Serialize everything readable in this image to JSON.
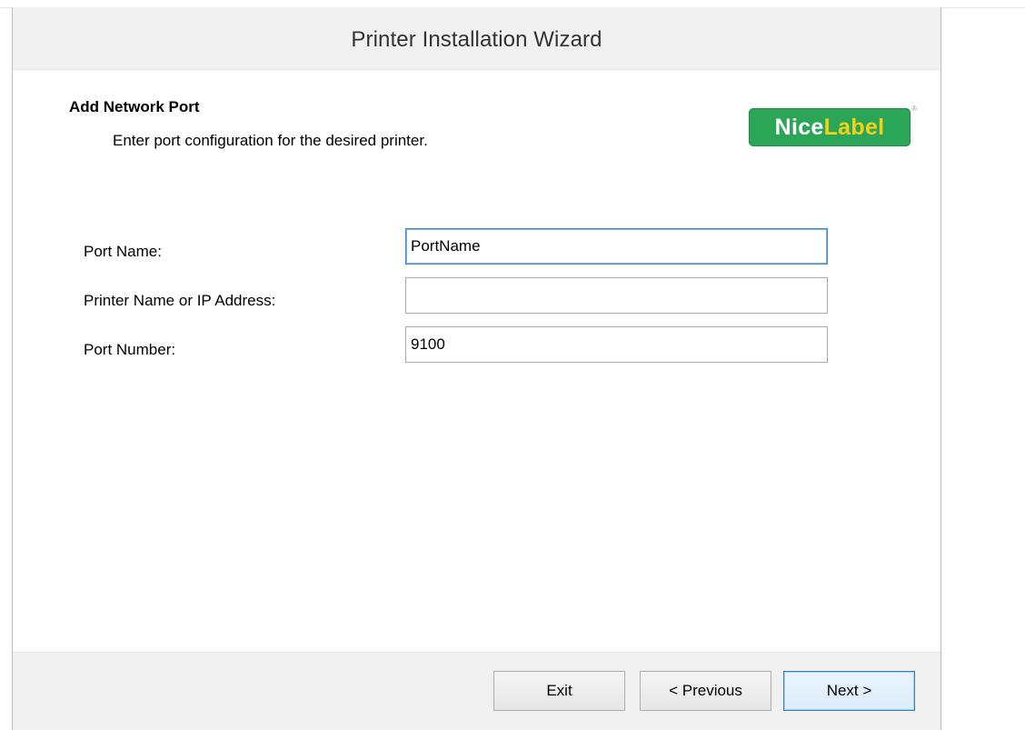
{
  "window": {
    "title": "Printer Installation Wizard"
  },
  "page": {
    "heading": "Add Network Port",
    "subheading": "Enter port configuration for the desired printer."
  },
  "logo": {
    "part1": "Nice",
    "part2": "Label",
    "registered": "®",
    "colors": {
      "background": "#2aa656",
      "nice": "#ffffff",
      "label": "#f3d11a"
    }
  },
  "form": {
    "port_name": {
      "label": "Port Name:",
      "value": "PortName"
    },
    "printer_address": {
      "label": "Printer Name or IP Address:",
      "value": ""
    },
    "port_number": {
      "label": "Port Number:",
      "value": "9100"
    }
  },
  "buttons": {
    "exit": "Exit",
    "previous": "< Previous",
    "next": "Next >"
  }
}
